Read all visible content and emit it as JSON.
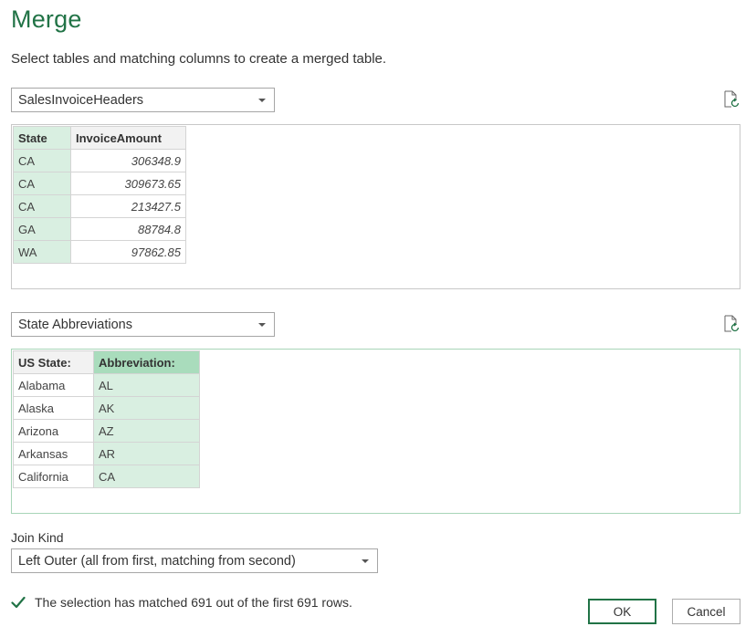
{
  "dialog": {
    "title": "Merge",
    "subtitle": "Select tables and matching columns to create a merged table."
  },
  "table1": {
    "selected": "SalesInvoiceHeaders",
    "refresh_icon": "refresh-document-icon",
    "columns": [
      "State",
      "InvoiceAmount"
    ],
    "rows": [
      [
        "CA",
        "306348.9"
      ],
      [
        "CA",
        "309673.65"
      ],
      [
        "CA",
        "213427.5"
      ],
      [
        "GA",
        "88784.8"
      ],
      [
        "WA",
        "97862.85"
      ]
    ]
  },
  "table2": {
    "selected": "State Abbreviations",
    "refresh_icon": "refresh-document-icon",
    "columns": [
      "US State:",
      "Abbreviation:"
    ],
    "rows": [
      [
        "Alabama",
        "AL"
      ],
      [
        "Alaska",
        "AK"
      ],
      [
        "Arizona",
        "AZ"
      ],
      [
        "Arkansas",
        "AR"
      ],
      [
        "California",
        "CA"
      ]
    ]
  },
  "join": {
    "label": "Join Kind",
    "selected": "Left Outer (all from first, matching from second)"
  },
  "status": {
    "icon": "checkmark-icon",
    "text": "The selection has matched 691 out of the first 691 rows."
  },
  "buttons": {
    "ok": "OK",
    "cancel": "Cancel"
  },
  "colors": {
    "accent": "#217346",
    "selected_column": "#d9efe1",
    "selected_header": "#a9dcbc"
  }
}
